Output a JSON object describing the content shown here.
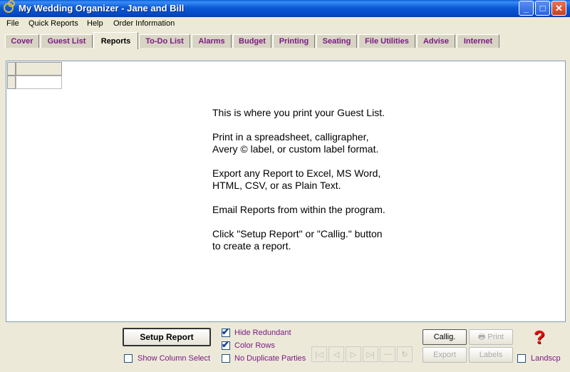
{
  "window": {
    "title": "My Wedding Organizer - Jane and Bill",
    "minimize": "_",
    "maximize": "□",
    "close": "✕"
  },
  "menu": [
    "File",
    "Quick Reports",
    "Help",
    "Order Information"
  ],
  "tabs": [
    "Cover",
    "Guest List",
    "Reports",
    "To-Do List",
    "Alarms",
    "Budget",
    "Printing",
    "Seating",
    "File Utilities",
    "Advise",
    "Internet"
  ],
  "active_tab": "Reports",
  "message": [
    "This is where you print your Guest List.",
    "Print in a spreadsheet, calligrapher,",
    "Avery © label, or custom label format.",
    "Export any Report to Excel, MS Word,",
    "HTML, CSV, or as Plain Text.",
    "Email Reports from within the program.",
    "Click \"Setup Report\" or \"Callig.\" button",
    "to create a report."
  ],
  "controls": {
    "setup_report": "Setup Report",
    "show_column_select": "Show Column Select",
    "hide_redundant": "Hide Redundant",
    "color_rows": "Color Rows",
    "no_duplicate_parties": "No Duplicate Parties",
    "callig": "Callig.",
    "print": "Print",
    "export": "Export",
    "labels": "Labels",
    "landscape": "Landscp"
  },
  "checkbox_states": {
    "show_column_select": false,
    "hide_redundant": true,
    "color_rows": true,
    "no_duplicate_parties": false,
    "landscape": false
  },
  "nav_buttons": [
    "|◁",
    "◁",
    "▷",
    "▷|",
    "—",
    "↻"
  ],
  "help_glyph": "?"
}
